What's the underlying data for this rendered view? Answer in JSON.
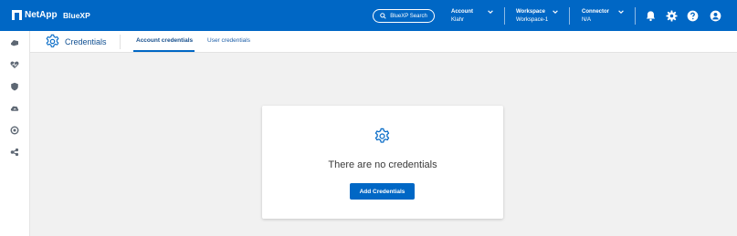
{
  "header": {
    "brand": "NetApp",
    "product": "BlueXP",
    "search_label": "BlueXP Search",
    "account": {
      "label": "Account",
      "value": "Klahr"
    },
    "workspace": {
      "label": "Workspace",
      "value": "Workspace-1"
    },
    "connector": {
      "label": "Connector",
      "value": "N/A"
    }
  },
  "subheader": {
    "title": "Credentials",
    "tabs": [
      {
        "label": "Account credentials",
        "active": true
      },
      {
        "label": "User credentials",
        "active": false
      }
    ]
  },
  "empty_state": {
    "message": "There are no credentials",
    "button_label": "Add Credentials"
  },
  "colors": {
    "brand_blue": "#0067c5",
    "background": "#f1f1f1"
  },
  "sidebar_icons": [
    "storage-icon",
    "health-icon",
    "protection-icon",
    "mobility-icon",
    "governance-icon",
    "share-icon"
  ]
}
